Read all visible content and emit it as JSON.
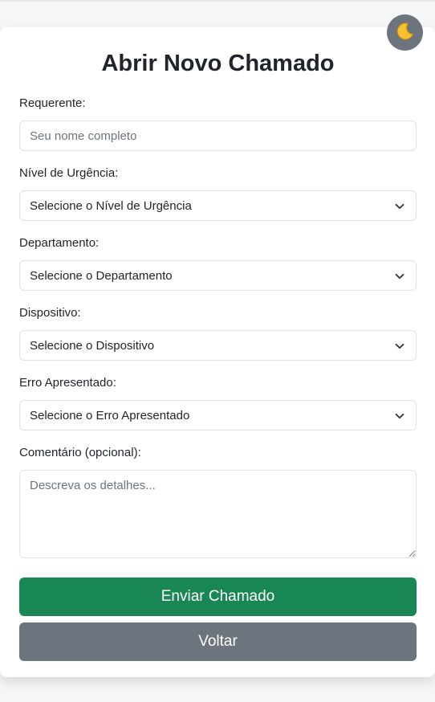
{
  "theme_toggle": {
    "icon": "moon-icon",
    "color": "#6c757d"
  },
  "page": {
    "title": "Abrir Novo Chamado"
  },
  "form": {
    "requester": {
      "label": "Requerente:",
      "placeholder": "Seu nome completo",
      "value": ""
    },
    "urgency": {
      "label": "Nível de Urgência:",
      "selected": "Selecione o Nível de Urgência"
    },
    "department": {
      "label": "Departamento:",
      "selected": "Selecione o Departamento"
    },
    "device": {
      "label": "Dispositivo:",
      "selected": "Selecione o Dispositivo"
    },
    "error": {
      "label": "Erro Apresentado:",
      "selected": "Selecione o Erro Apresentado"
    },
    "comment": {
      "label": "Comentário (opcional):",
      "placeholder": "Descreva os detalhes..."
    }
  },
  "actions": {
    "submit_label": "Enviar Chamado",
    "submit_color": "#198754",
    "back_label": "Voltar",
    "back_color": "#6c757d"
  }
}
